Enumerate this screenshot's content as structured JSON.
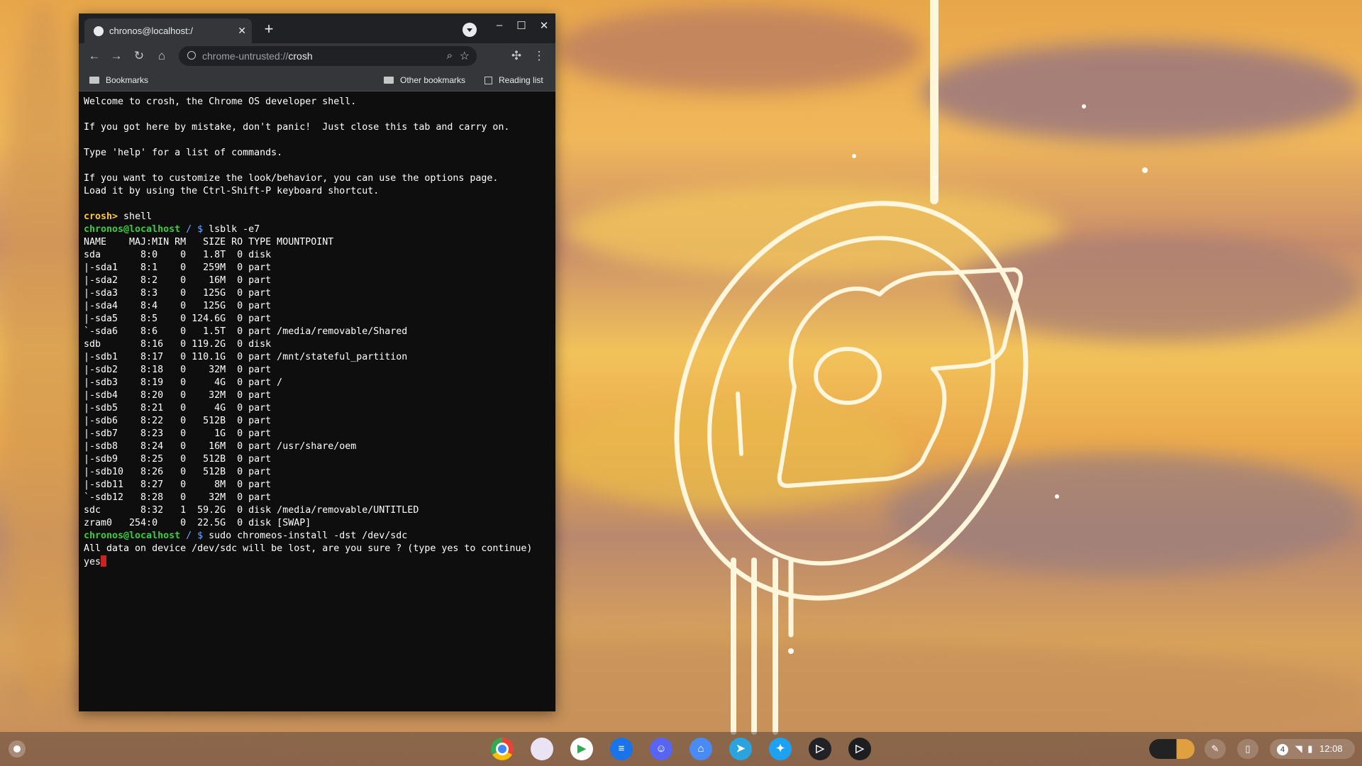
{
  "browser": {
    "tab_title": "chronos@localhost:/",
    "url_scheme": "chrome-untrusted://",
    "url_host": "crosh",
    "bookmarks_label": "Bookmarks",
    "other_bookmarks_label": "Other bookmarks",
    "reading_list_label": "Reading list"
  },
  "terminal": {
    "intro": [
      "Welcome to crosh, the Chrome OS developer shell.",
      "",
      "If you got here by mistake, don't panic!  Just close this tab and carry on.",
      "",
      "Type 'help' for a list of commands.",
      "",
      "If you want to customize the look/behavior, you can use the options page.",
      "Load it by using the Ctrl-Shift-P keyboard shortcut.",
      ""
    ],
    "crosh_prompt": "crosh>",
    "crosh_cmd": " shell",
    "user_prompt": "chronos@localhost",
    "path_sep": " / $ ",
    "cmd1": "lsblk -e7",
    "lsblk": [
      "NAME    MAJ:MIN RM   SIZE RO TYPE MOUNTPOINT",
      "sda       8:0    0   1.8T  0 disk",
      "|-sda1    8:1    0   259M  0 part",
      "|-sda2    8:2    0    16M  0 part",
      "|-sda3    8:3    0   125G  0 part",
      "|-sda4    8:4    0   125G  0 part",
      "|-sda5    8:5    0 124.6G  0 part",
      "`-sda6    8:6    0   1.5T  0 part /media/removable/Shared",
      "sdb       8:16   0 119.2G  0 disk",
      "|-sdb1    8:17   0 110.1G  0 part /mnt/stateful_partition",
      "|-sdb2    8:18   0    32M  0 part",
      "|-sdb3    8:19   0     4G  0 part /",
      "|-sdb4    8:20   0    32M  0 part",
      "|-sdb5    8:21   0     4G  0 part",
      "|-sdb6    8:22   0   512B  0 part",
      "|-sdb7    8:23   0     1G  0 part",
      "|-sdb8    8:24   0    16M  0 part /usr/share/oem",
      "|-sdb9    8:25   0   512B  0 part",
      "|-sdb10   8:26   0   512B  0 part",
      "|-sdb11   8:27   0     8M  0 part",
      "`-sdb12   8:28   0    32M  0 part",
      "sdc       8:32   1  59.2G  0 disk /media/removable/UNTITLED",
      "zram0   254:0    0  22.5G  0 disk [SWAP]"
    ],
    "cmd2": "sudo chromeos-install -dst /dev/sdc",
    "warning": "All data on device /dev/sdc will be lost, are you sure ? (type yes to continue)",
    "answer": "yes"
  },
  "shelf": {
    "apps": [
      {
        "name": "chrome-icon",
        "color": "#ffffff",
        "glyph": ""
      },
      {
        "name": "gallery-app-icon",
        "color": "#e9e3f3",
        "glyph": ""
      },
      {
        "name": "play-store-icon",
        "color": "#ffffff",
        "glyph": "▶"
      },
      {
        "name": "messages-icon",
        "color": "#1a73e8",
        "glyph": "≡"
      },
      {
        "name": "discord-icon",
        "color": "#5865f2",
        "glyph": "☺"
      },
      {
        "name": "chat-app-icon",
        "color": "#4a8af4",
        "glyph": "⌂"
      },
      {
        "name": "telegram-icon",
        "color": "#2aa3df",
        "glyph": "➤"
      },
      {
        "name": "twitter-icon",
        "color": "#1da1f2",
        "glyph": "✦"
      },
      {
        "name": "media-app-icon",
        "color": "#222226",
        "glyph": "▷"
      },
      {
        "name": "player-app-icon",
        "color": "#1d1d22",
        "glyph": "▷"
      }
    ],
    "notification_count": "4",
    "time": "12:08"
  }
}
